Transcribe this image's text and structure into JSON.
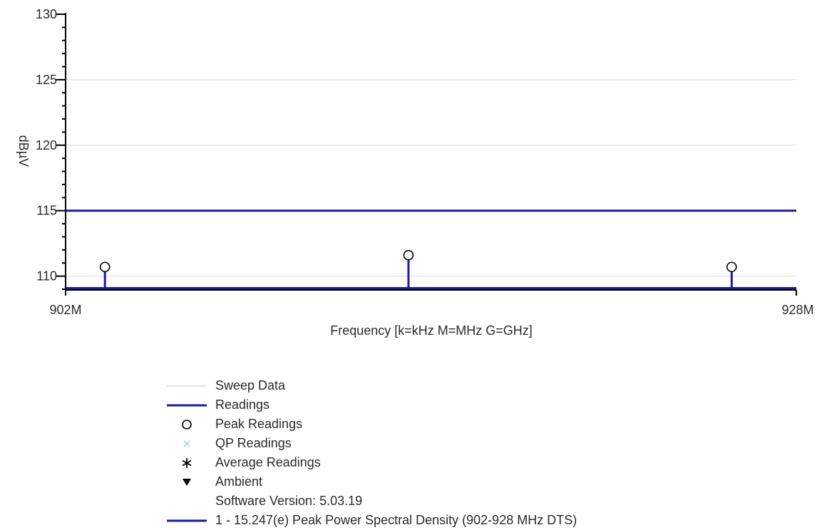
{
  "chart_data": {
    "type": "line",
    "title": "",
    "xlabel": "Frequency [k=kHz M=MHz G=GHz]",
    "ylabel": "dBµV",
    "xlim": [
      902,
      928
    ],
    "ylim": [
      109,
      130
    ],
    "x_tick_labels": [
      "902M",
      "928M"
    ],
    "y_ticks": [
      110,
      115,
      120,
      125,
      130
    ],
    "y_tick_labels": [
      "110",
      "115",
      "120",
      "125",
      "130"
    ],
    "grid": true,
    "legend_position": "bottom",
    "series": [
      {
        "name": "Readings",
        "type": "stem",
        "x": [
          903.4,
          914.2,
          925.7
        ],
        "values": [
          110.7,
          111.6,
          110.7
        ]
      },
      {
        "name": "Peak Readings",
        "type": "marker",
        "x": [
          903.4,
          914.2,
          925.7
        ],
        "values": [
          110.7,
          111.6,
          110.7
        ]
      },
      {
        "name": "1 - 15.247(e) Peak Power Spectral Density (902-928 MHz DTS)",
        "type": "limit",
        "x": [
          902,
          928
        ],
        "values": [
          115,
          115
        ]
      }
    ],
    "colors": {
      "readings": "#1a1aa6",
      "limit": "#1a1aa6",
      "sweep": "#c8c8c8",
      "qp": "#9fd4e6",
      "axis": "#000000",
      "grid": "#d9d9d9"
    }
  },
  "legend": {
    "items": [
      {
        "key": "sweep",
        "label": "Sweep Data",
        "symbol": "thin-line-icon"
      },
      {
        "key": "readings",
        "label": "Readings",
        "symbol": "blue-line-icon"
      },
      {
        "key": "peak",
        "label": "Peak Readings",
        "symbol": "circle-icon"
      },
      {
        "key": "qp",
        "label": "QP Readings",
        "symbol": "x-mark-icon"
      },
      {
        "key": "average",
        "label": "Average Readings",
        "symbol": "asterisk-icon"
      },
      {
        "key": "ambient",
        "label": "Ambient",
        "symbol": "triangle-down-icon"
      },
      {
        "key": "version",
        "label": "Software Version: 5.03.19",
        "symbol": ""
      },
      {
        "key": "limit",
        "label": "1 - 15.247(e) Peak Power Spectral Density (902-928 MHz DTS)",
        "symbol": "blue-line-icon"
      }
    ]
  }
}
